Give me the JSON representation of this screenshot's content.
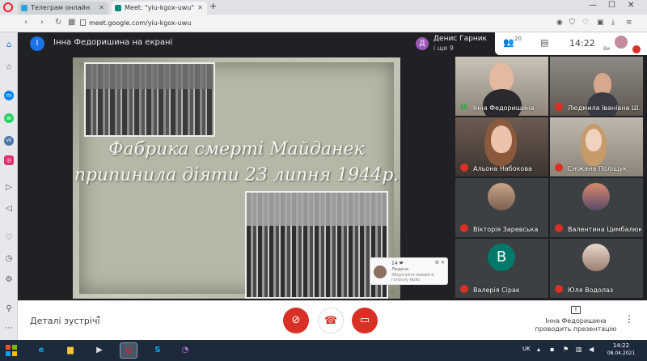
{
  "browser": {
    "tabs": [
      {
        "label": "Телеграм онлайн",
        "icon": "telegram-icon",
        "color": "#2aa3df"
      },
      {
        "label": "Meet: \"yiu-kgox-uwu\"",
        "icon": "meet-icon",
        "color": "#00897b"
      }
    ],
    "url": "meet.google.com/yiu-kgox-uwu"
  },
  "meet": {
    "presenter_avatar_letter": "І",
    "presenter_label": "Інна Федоришина на екрані",
    "speaker_avatar_letter": "Д",
    "speaker_name": "Денис Гарник",
    "speaker_more": "і ще 9",
    "people_count": "20",
    "time": "14:22",
    "self_label": "Ви"
  },
  "slide": {
    "title_line1": "Фабрика смерті Майданек",
    "title_line2": "припинила діяти 23 липня 1944р."
  },
  "notification": {
    "count": "14 ❤",
    "name": "Людина",
    "text": "Зберігайте живий й голосну мрію"
  },
  "participants": [
    {
      "name": "Інна Федоришина",
      "mic": "on"
    },
    {
      "name": "Людмила Іванівна Ш...",
      "mic": "off"
    },
    {
      "name": "Альона Набокова",
      "mic": "off"
    },
    {
      "name": "Сніжана Поліщук",
      "mic": "off"
    },
    {
      "name": "Вікторія Заревська",
      "mic": "off"
    },
    {
      "name": "Валентина Цимбалюк",
      "mic": "off"
    },
    {
      "name": "Валерія Сірак",
      "mic": "off",
      "avatar_letter": "В"
    },
    {
      "name": "Юля Водолаз",
      "mic": "off"
    }
  ],
  "controls": {
    "details_label": "Деталі зустрічі",
    "present_label_line1": "Інна Федоришина",
    "present_label_line2": "проводить презентацію"
  },
  "taskbar": {
    "lang": "UK",
    "time": "14:22",
    "date": "08.04.2021"
  }
}
